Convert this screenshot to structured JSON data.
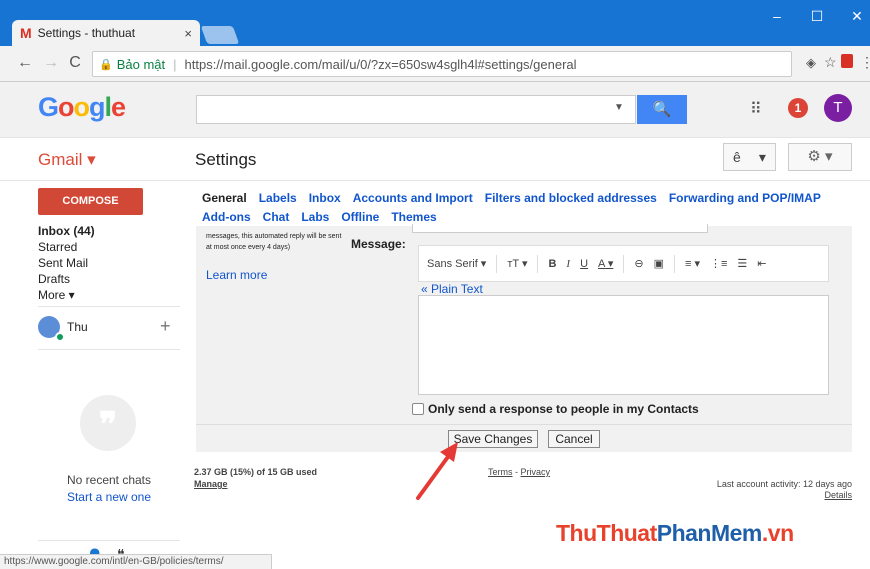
{
  "browser": {
    "tab_title": "Settings - thuthuat",
    "tab_close": "×",
    "tab_logo": "M",
    "window_controls": {
      "minimize": "–",
      "maximize": "☐",
      "close": "✕"
    },
    "nav": {
      "back": "←",
      "forward": "→",
      "reload": "C"
    },
    "secure_label": "Bảo mật",
    "url": "https://mail.google.com/mail/u/0/?zx=650sw4sglh4l#settings/general",
    "status_url": "https://www.google.com/intl/en-GB/policies/terms/"
  },
  "header": {
    "logo_letters": [
      {
        "ch": "G",
        "color": "#4285f4"
      },
      {
        "ch": "o",
        "color": "#ea4335"
      },
      {
        "ch": "o",
        "color": "#fbbc05"
      },
      {
        "ch": "g",
        "color": "#4285f4"
      },
      {
        "ch": "l",
        "color": "#34a853"
      },
      {
        "ch": "e",
        "color": "#ea4335"
      }
    ],
    "search_placeholder": "",
    "search_dropdown": "▼",
    "search_icon": "🔍",
    "apps_icon": "⠿",
    "notification_count": "1",
    "avatar_letter": "T"
  },
  "subheader": {
    "gmail_label": "Gmail ▾",
    "page_title": "Settings",
    "lang_value": "ê",
    "lang_caret": "▾",
    "gear_label": "⚙ ▾"
  },
  "sidebar": {
    "compose": "COMPOSE",
    "items": [
      "Inbox (44)",
      "Starred",
      "Sent Mail",
      "Drafts",
      "More ▾"
    ],
    "hangouts_name": "Thu",
    "hangouts_plus": "+",
    "no_chats": "No recent chats",
    "start_new": "Start a new one"
  },
  "settings": {
    "tabs_row1": [
      "General",
      "Labels",
      "Inbox",
      "Accounts and Import",
      "Filters and blocked addresses",
      "Forwarding and POP/IMAP"
    ],
    "tabs_row2": [
      "Add-ons",
      "Chat",
      "Labs",
      "Offline",
      "Themes"
    ],
    "active_tab": "General",
    "description": "messages, this automated reply will be sent at most once every 4 days)",
    "learn_more": "Learn more",
    "message_label": "Message:",
    "toolbar": {
      "font": "Sans Serif ▾",
      "size": "тT ▾",
      "bold": "B",
      "italic": "I",
      "underline": "U",
      "text_color": "A ▾",
      "link": "⊖",
      "image": "▣",
      "align": "≡ ▾",
      "numbered": "⋮≡",
      "bulleted": "☰",
      "indent": "⇤"
    },
    "plain_text": "« Plain Text",
    "only_send": "Only send a response to people in my Contacts",
    "save": "Save Changes",
    "cancel": "Cancel"
  },
  "footer": {
    "storage": "2.37 GB (15%) of 15 GB used",
    "manage": "Manage",
    "terms": "Terms",
    "dash": " - ",
    "privacy": "Privacy",
    "last_activity": "Last account activity: 12 days ago",
    "details": "Details"
  },
  "watermark": {
    "parts": [
      {
        "text": "ThuThuat",
        "color": "#e8412c"
      },
      {
        "text": "PhanMem",
        "color": "#1f5fa8"
      },
      {
        "text": ".vn",
        "color": "#e8412c"
      }
    ]
  },
  "colors": {
    "compose": "#d14836",
    "link": "#1155cc",
    "chrome": "#1874d3",
    "arrow": "#e53935"
  }
}
